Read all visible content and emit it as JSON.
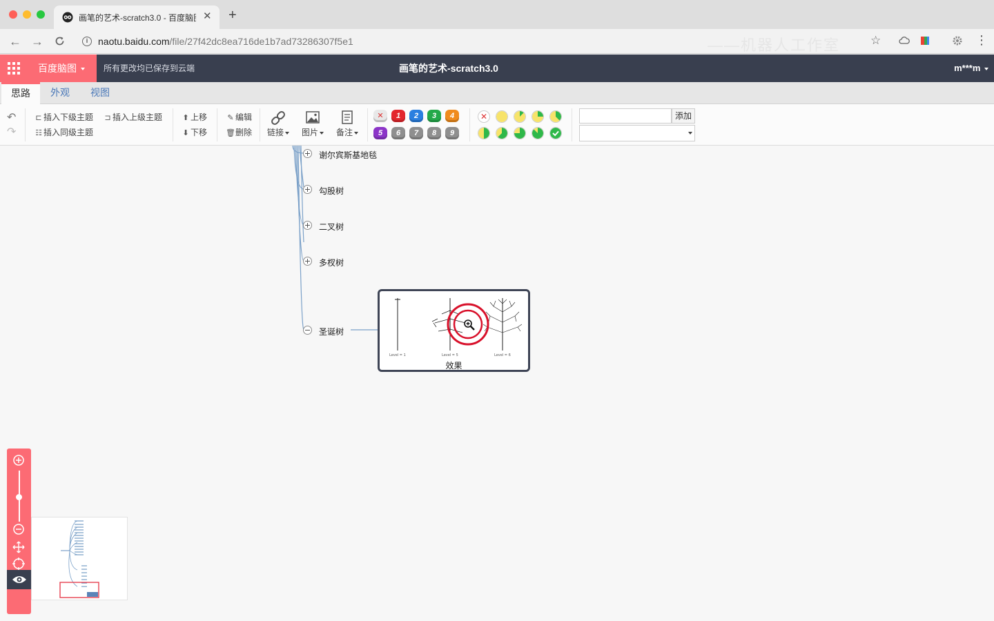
{
  "browser": {
    "tab_title": "画笔的艺术-scratch3.0 - 百度脑图",
    "url_host": "naotu.baidu.com",
    "url_path": "/file/27f42dc8ea716de1b7ad73286307f5e1",
    "watermark": "——机器人工作室"
  },
  "app": {
    "brand": "百度脑图",
    "save_status": "所有更改均已保存到云端",
    "doc_title": "画笔的艺术-scratch3.0",
    "user": "m***m"
  },
  "tabs": [
    {
      "label": "思路",
      "active": true
    },
    {
      "label": "外观",
      "active": false
    },
    {
      "label": "视图",
      "active": false
    }
  ],
  "toolbar": {
    "insert_child": "插入下级主题",
    "insert_parent": "插入上级主题",
    "insert_sibling": "插入同级主题",
    "move_up": "上移",
    "move_down": "下移",
    "edit": "编辑",
    "delete": "删除",
    "link": "链接",
    "image": "图片",
    "note": "备注",
    "resource_add": "添加"
  },
  "priority": {
    "top": [
      "1",
      "2",
      "3",
      "4"
    ],
    "bottom": [
      "5",
      "6",
      "7",
      "8",
      "9"
    ],
    "colors": {
      "1": "#e3262d",
      "2": "#2a7fe0",
      "3": "#23a94a",
      "4": "#f08b1c",
      "5": "#8c35c8",
      "gray": "#8f8f8f"
    }
  },
  "progress_levels": {
    "top": [
      0,
      0.125,
      0.25,
      0.375
    ],
    "bottom": [
      0.5,
      0.625,
      0.75,
      0.875,
      1
    ]
  },
  "mindmap": {
    "nodes": [
      {
        "label": "谢尔宾斯基地毯",
        "collapsed": true
      },
      {
        "label": "勾股树",
        "collapsed": true
      },
      {
        "label": "二叉树",
        "collapsed": true
      },
      {
        "label": "多杈树",
        "collapsed": true
      },
      {
        "label": "圣诞树",
        "collapsed": false
      }
    ],
    "image_child": {
      "caption": "效果",
      "level_labels": [
        "Level = 1",
        "Level = 5",
        "Level = 6"
      ]
    }
  }
}
